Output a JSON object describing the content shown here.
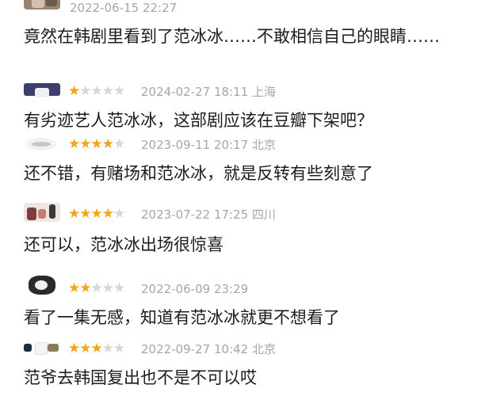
{
  "comments": [
    {
      "rating": null,
      "time": "2022-06-15 22:27",
      "location": "",
      "text": "竟然在韩剧里看到了范冰冰……不敢相信自己的眼睛……"
    },
    {
      "rating": 1,
      "time": "2024-02-27 18:11",
      "location": "上海",
      "text": "有劣迹艺人范冰冰，这部剧应该在豆瓣下架吧？"
    },
    {
      "rating": 4,
      "time": "2023-09-11 20:17",
      "location": "北京",
      "text": "还不错，有赌场和范冰冰，就是反转有些刻意了"
    },
    {
      "rating": 4,
      "time": "2023-07-22 17:25",
      "location": "四川",
      "text": "还可以，范冰冰出场很惊喜"
    },
    {
      "rating": 2,
      "time": "2022-06-09 23:29",
      "location": "",
      "text": "看了一集无感，知道有范冰冰就更不想看了"
    },
    {
      "rating": 3,
      "time": "2022-09-27 10:42",
      "location": "北京",
      "text": "范爷去韩国复出也不是不可以哎"
    }
  ],
  "star_glyph": "★",
  "colors": {
    "star_on": "#f4a516",
    "star_off": "#d6d6d6",
    "meta_text": "#a6a6a6",
    "body_text": "#1c1c1c"
  },
  "icons": {
    "avatar": "user-avatar-icon",
    "star": "star-icon"
  }
}
